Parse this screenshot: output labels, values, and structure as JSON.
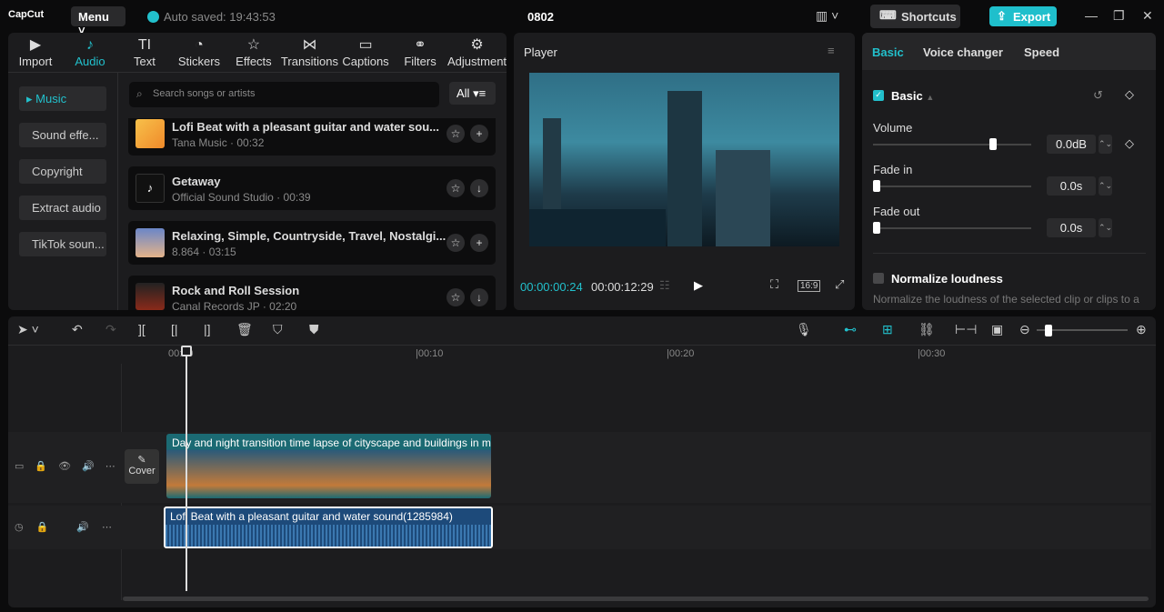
{
  "app": {
    "logo": "CapCut",
    "menu": "Menu",
    "autosave": "Auto saved: 19:43:53",
    "project": "0802",
    "shortcuts": "Shortcuts",
    "export": "Export"
  },
  "toolbar": [
    {
      "label": "Import",
      "icon": "▶"
    },
    {
      "label": "Audio",
      "icon": "♪"
    },
    {
      "label": "Text",
      "icon": "TI"
    },
    {
      "label": "Stickers",
      "icon": "◔"
    },
    {
      "label": "Effects",
      "icon": "☆"
    },
    {
      "label": "Transitions",
      "icon": "⋈"
    },
    {
      "label": "Captions",
      "icon": "▭"
    },
    {
      "label": "Filters",
      "icon": "⚭"
    },
    {
      "label": "Adjustment",
      "icon": "⚙"
    }
  ],
  "audio_sidebar": [
    "▸ Music",
    "Sound effe...",
    "Copyright",
    "Extract audio",
    "TikTok soun..."
  ],
  "search": {
    "placeholder": "Search songs or artists",
    "filter": "All"
  },
  "songs": [
    {
      "title": "Lofi Beat with a pleasant guitar and water sou...",
      "meta": "Tana Music · 00:32",
      "action": "+"
    },
    {
      "title": "Getaway",
      "meta": "Official Sound Studio · 00:39",
      "action": "↓"
    },
    {
      "title": "Relaxing, Simple, Countryside, Travel, Nostalgi...",
      "meta": "8.864 · 03:15",
      "action": "+"
    },
    {
      "title": "Rock and Roll Session",
      "meta": "Canal Records JP · 02:20",
      "action": "↓"
    }
  ],
  "player": {
    "title": "Player",
    "current": "00:00:00:24",
    "total": "00:00:12:29",
    "ratio": "16:9"
  },
  "props": {
    "tabs": [
      "Basic",
      "Voice changer",
      "Speed"
    ],
    "section": "Basic",
    "volume": {
      "label": "Volume",
      "value": "0.0dB",
      "fraction": 0.75
    },
    "fade_in": {
      "label": "Fade in",
      "value": "0.0s",
      "fraction": 0
    },
    "fade_out": {
      "label": "Fade out",
      "value": "0.0s",
      "fraction": 0
    },
    "normalize": {
      "label": "Normalize loudness",
      "desc": "Normalize the loudness of the selected clip or clips to a"
    }
  },
  "timeline": {
    "ticks": [
      "00:00",
      "|00:10",
      "|00:20",
      "|00:30"
    ],
    "cover": "Cover",
    "video_clip": "Day and night transition time lapse of cityscape and buildings in m",
    "audio_clip": "Lofi Beat with a pleasant guitar and water sound(1285984)"
  },
  "colors": {
    "accent": "#22c0cc"
  }
}
